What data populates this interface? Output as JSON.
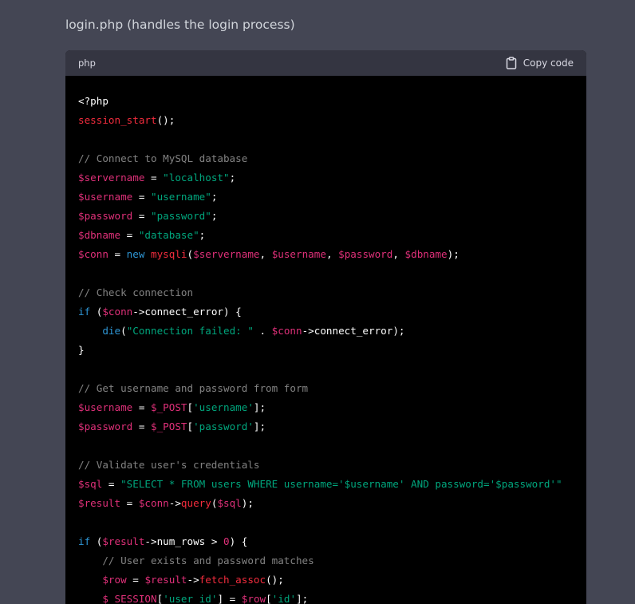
{
  "heading": "login.php (handles the login process)",
  "code_block": {
    "language": "php",
    "copy_label": "Copy code",
    "copy_icon": "clipboard-icon",
    "colors": {
      "header_bg": "#343541",
      "body_bg": "#000000",
      "page_bg": "#444654"
    },
    "lines": [
      [
        {
          "t": "meta",
          "v": "<?php"
        }
      ],
      [
        {
          "t": "func",
          "v": "session_start"
        },
        {
          "t": "plain",
          "v": "();"
        }
      ],
      [],
      [
        {
          "t": "comment",
          "v": "// Connect to MySQL database"
        }
      ],
      [
        {
          "t": "var",
          "v": "$servername"
        },
        {
          "t": "plain",
          "v": " = "
        },
        {
          "t": "str",
          "v": "\"localhost\""
        },
        {
          "t": "plain",
          "v": ";"
        }
      ],
      [
        {
          "t": "var",
          "v": "$username"
        },
        {
          "t": "plain",
          "v": " = "
        },
        {
          "t": "str",
          "v": "\"username\""
        },
        {
          "t": "plain",
          "v": ";"
        }
      ],
      [
        {
          "t": "var",
          "v": "$password"
        },
        {
          "t": "plain",
          "v": " = "
        },
        {
          "t": "str",
          "v": "\"password\""
        },
        {
          "t": "plain",
          "v": ";"
        }
      ],
      [
        {
          "t": "var",
          "v": "$dbname"
        },
        {
          "t": "plain",
          "v": " = "
        },
        {
          "t": "str",
          "v": "\"database\""
        },
        {
          "t": "plain",
          "v": ";"
        }
      ],
      [
        {
          "t": "var",
          "v": "$conn"
        },
        {
          "t": "plain",
          "v": " = "
        },
        {
          "t": "keyword",
          "v": "new"
        },
        {
          "t": "plain",
          "v": " "
        },
        {
          "t": "func",
          "v": "mysqli"
        },
        {
          "t": "plain",
          "v": "("
        },
        {
          "t": "var",
          "v": "$servername"
        },
        {
          "t": "plain",
          "v": ", "
        },
        {
          "t": "var",
          "v": "$username"
        },
        {
          "t": "plain",
          "v": ", "
        },
        {
          "t": "var",
          "v": "$password"
        },
        {
          "t": "plain",
          "v": ", "
        },
        {
          "t": "var",
          "v": "$dbname"
        },
        {
          "t": "plain",
          "v": ");"
        }
      ],
      [],
      [
        {
          "t": "comment",
          "v": "// Check connection"
        }
      ],
      [
        {
          "t": "keyword",
          "v": "if"
        },
        {
          "t": "plain",
          "v": " ("
        },
        {
          "t": "var",
          "v": "$conn"
        },
        {
          "t": "plain",
          "v": "->connect_error) {"
        }
      ],
      [
        {
          "t": "plain",
          "v": "    "
        },
        {
          "t": "keyword",
          "v": "die"
        },
        {
          "t": "plain",
          "v": "("
        },
        {
          "t": "str",
          "v": "\"Connection failed: \""
        },
        {
          "t": "plain",
          "v": " . "
        },
        {
          "t": "var",
          "v": "$conn"
        },
        {
          "t": "plain",
          "v": "->connect_error);"
        }
      ],
      [
        {
          "t": "plain",
          "v": "}"
        }
      ],
      [],
      [
        {
          "t": "comment",
          "v": "// Get username and password from form"
        }
      ],
      [
        {
          "t": "var",
          "v": "$username"
        },
        {
          "t": "plain",
          "v": " = "
        },
        {
          "t": "var",
          "v": "$_POST"
        },
        {
          "t": "plain",
          "v": "["
        },
        {
          "t": "str",
          "v": "'username'"
        },
        {
          "t": "plain",
          "v": "];"
        }
      ],
      [
        {
          "t": "var",
          "v": "$password"
        },
        {
          "t": "plain",
          "v": " = "
        },
        {
          "t": "var",
          "v": "$_POST"
        },
        {
          "t": "plain",
          "v": "["
        },
        {
          "t": "str",
          "v": "'password'"
        },
        {
          "t": "plain",
          "v": "];"
        }
      ],
      [],
      [
        {
          "t": "comment",
          "v": "// Validate user's credentials"
        }
      ],
      [
        {
          "t": "var",
          "v": "$sql"
        },
        {
          "t": "plain",
          "v": " = "
        },
        {
          "t": "str",
          "v": "\"SELECT * FROM users WHERE username='$username' AND password='$password'\""
        }
      ],
      [
        {
          "t": "var",
          "v": "$result"
        },
        {
          "t": "plain",
          "v": " = "
        },
        {
          "t": "var",
          "v": "$conn"
        },
        {
          "t": "plain",
          "v": "->"
        },
        {
          "t": "func",
          "v": "query"
        },
        {
          "t": "plain",
          "v": "("
        },
        {
          "t": "var",
          "v": "$sql"
        },
        {
          "t": "plain",
          "v": ");"
        }
      ],
      [],
      [
        {
          "t": "keyword",
          "v": "if"
        },
        {
          "t": "plain",
          "v": " ("
        },
        {
          "t": "var",
          "v": "$result"
        },
        {
          "t": "plain",
          "v": "->num_rows > "
        },
        {
          "t": "num",
          "v": "0"
        },
        {
          "t": "plain",
          "v": ") {"
        }
      ],
      [
        {
          "t": "plain",
          "v": "    "
        },
        {
          "t": "comment",
          "v": "// User exists and password matches"
        }
      ],
      [
        {
          "t": "plain",
          "v": "    "
        },
        {
          "t": "var",
          "v": "$row"
        },
        {
          "t": "plain",
          "v": " = "
        },
        {
          "t": "var",
          "v": "$result"
        },
        {
          "t": "plain",
          "v": "->"
        },
        {
          "t": "func",
          "v": "fetch_assoc"
        },
        {
          "t": "plain",
          "v": "();"
        }
      ],
      [
        {
          "t": "plain",
          "v": "    "
        },
        {
          "t": "var",
          "v": "$_SESSION"
        },
        {
          "t": "plain",
          "v": "["
        },
        {
          "t": "str",
          "v": "'user_id'"
        },
        {
          "t": "plain",
          "v": "] = "
        },
        {
          "t": "var",
          "v": "$row"
        },
        {
          "t": "plain",
          "v": "["
        },
        {
          "t": "str",
          "v": "'id'"
        },
        {
          "t": "plain",
          "v": "];"
        }
      ]
    ]
  }
}
